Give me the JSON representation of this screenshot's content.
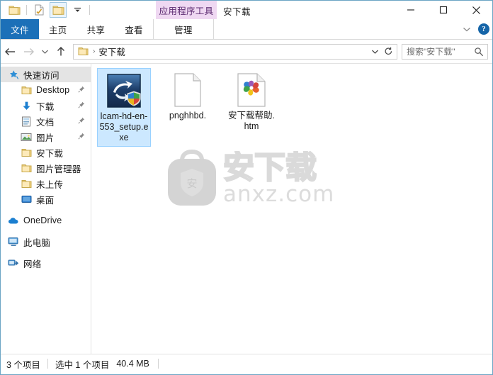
{
  "window": {
    "title": "安下载",
    "contextual_tab_header": "应用程序工具",
    "controls": {
      "minimize": "minimize-button",
      "maximize": "maximize-button",
      "close": "close-button"
    }
  },
  "quick_access_toolbar": {
    "items": [
      {
        "name": "folder-icon",
        "label": "属性"
      },
      {
        "name": "properties-icon",
        "label": "属性"
      },
      {
        "name": "new-folder-icon",
        "label": "新建文件夹"
      },
      {
        "name": "customize-dropdown-icon",
        "label": "自定义快速访问工具栏"
      }
    ]
  },
  "ribbon": {
    "tabs": [
      {
        "id": "file",
        "label": "文件",
        "active": false,
        "style": "file"
      },
      {
        "id": "home",
        "label": "主页",
        "active": false,
        "style": "normal"
      },
      {
        "id": "share",
        "label": "共享",
        "active": false,
        "style": "normal"
      },
      {
        "id": "view",
        "label": "查看",
        "active": false,
        "style": "normal"
      },
      {
        "id": "manage",
        "label": "管理",
        "active": true,
        "style": "contextual"
      }
    ],
    "collapse_label": "展开功能区",
    "help_label": "?"
  },
  "address_bar": {
    "back_label": "后退",
    "forward_label": "前进",
    "recent_label": "最近浏览的位置",
    "up_label": "向上",
    "breadcrumb": {
      "folder_icon": "folder-icon",
      "separator": "›",
      "path": "安下载"
    },
    "dropdown_label": "展开",
    "refresh_label": "刷新"
  },
  "search": {
    "placeholder": "搜索\"安下载\"",
    "icon": "search-icon"
  },
  "sidebar": {
    "items": [
      {
        "label": "快速访问",
        "icon": "star-pin-icon",
        "indent": "root",
        "selected": true,
        "pinned": false
      },
      {
        "label": "Desktop",
        "icon": "folder-icon",
        "indent": "one",
        "selected": false,
        "pinned": true
      },
      {
        "label": "下载",
        "icon": "download-arrow-icon",
        "indent": "one",
        "selected": false,
        "pinned": true
      },
      {
        "label": "文档",
        "icon": "documents-icon",
        "indent": "one",
        "selected": false,
        "pinned": true
      },
      {
        "label": "图片",
        "icon": "pictures-icon",
        "indent": "one",
        "selected": false,
        "pinned": true
      },
      {
        "label": "安下载",
        "icon": "folder-icon",
        "indent": "one",
        "selected": false,
        "pinned": false
      },
      {
        "label": "图片管理器",
        "icon": "folder-icon",
        "indent": "one",
        "selected": false,
        "pinned": false
      },
      {
        "label": "未上传",
        "icon": "folder-icon",
        "indent": "one",
        "selected": false,
        "pinned": false
      },
      {
        "label": "桌面",
        "icon": "desktop-icon",
        "indent": "one",
        "selected": false,
        "pinned": false
      },
      {
        "label": "OneDrive",
        "icon": "onedrive-cloud-icon",
        "indent": "root",
        "selected": false,
        "pinned": false
      },
      {
        "label": "此电脑",
        "icon": "this-pc-icon",
        "indent": "root",
        "selected": false,
        "pinned": false
      },
      {
        "label": "网络",
        "icon": "network-icon",
        "indent": "root",
        "selected": false,
        "pinned": false
      }
    ]
  },
  "files": {
    "items": [
      {
        "name": "lcam-hd-en-553_setup.exe",
        "icon": "installer-exe-icon",
        "selected": true
      },
      {
        "name": "pnghhbd.",
        "icon": "blank-document-icon",
        "selected": false
      },
      {
        "name": "安下载帮助.htm",
        "icon": "html-pinwheel-icon",
        "selected": false
      }
    ]
  },
  "watermark": {
    "logo_glyph": "安",
    "brand": "安下载",
    "domain": "anxz.com"
  },
  "status_bar": {
    "item_count": "3 个项目",
    "selection": "选中 1 个项目",
    "size": "40.4 MB"
  },
  "colors": {
    "file_tab_blue": "#1c70b8",
    "contextual_purple": "#efd8f2",
    "contextual_purple_text": "#5b2a70",
    "selection_blue": "#cce8ff",
    "window_border": "#6ba5c4"
  }
}
